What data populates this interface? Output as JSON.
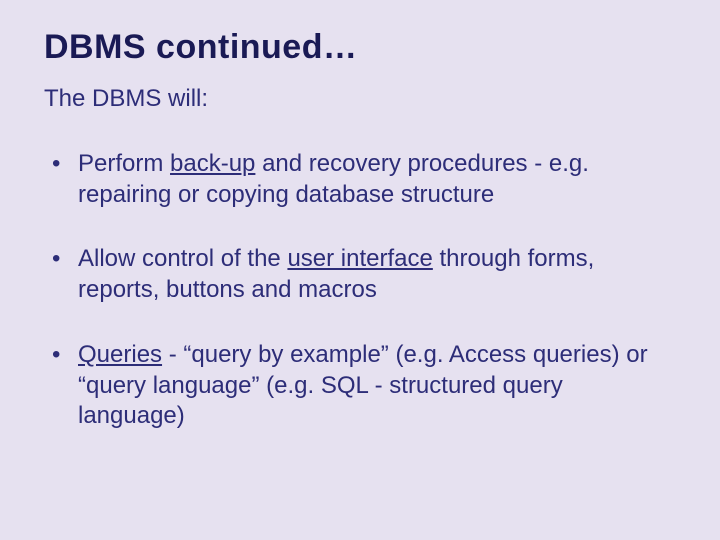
{
  "title": "DBMS continued…",
  "intro": "The DBMS will:",
  "bullets": [
    {
      "pre": "Perform ",
      "u": "back-up",
      "post": " and recovery procedures - e.g. repairing or copying database structure"
    },
    {
      "pre": "Allow control of the ",
      "u": "user interface",
      "post": " through forms, reports, buttons and macros"
    },
    {
      "pre": "",
      "u": "Queries",
      "post": " - “query by example” (e.g. Access queries) or “query language” (e.g. SQL - structured query language)"
    }
  ]
}
